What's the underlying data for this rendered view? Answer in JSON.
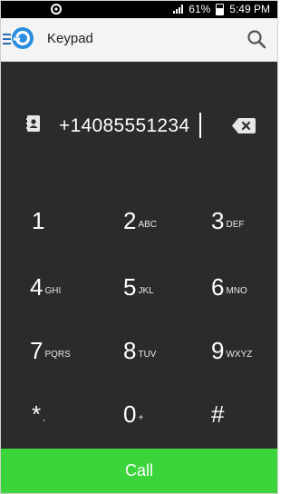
{
  "status_bar": {
    "battery": "61%",
    "time": "5:49 PM"
  },
  "app_bar": {
    "title": "Keypad"
  },
  "dialer": {
    "number": "+14085551234"
  },
  "keypad": {
    "keys": [
      {
        "digit": "1",
        "letters": ""
      },
      {
        "digit": "2",
        "letters": "ABC"
      },
      {
        "digit": "3",
        "letters": "DEF"
      },
      {
        "digit": "4",
        "letters": "GHI"
      },
      {
        "digit": "5",
        "letters": "JKL"
      },
      {
        "digit": "6",
        "letters": "MNO"
      },
      {
        "digit": "7",
        "letters": "PQRS"
      },
      {
        "digit": "8",
        "letters": "TUV"
      },
      {
        "digit": "9",
        "letters": "WXYZ"
      },
      {
        "digit": "*",
        "letters": ","
      },
      {
        "digit": "0",
        "letters": "+"
      },
      {
        "digit": "#",
        "letters": ""
      }
    ]
  },
  "call_button": {
    "label": "Call"
  },
  "colors": {
    "call_green": "#3bd43a",
    "keypad_bg": "#2b2b2b",
    "app_bar_bg": "#f4f4f4",
    "accent_blue": "#2a6fb3"
  }
}
